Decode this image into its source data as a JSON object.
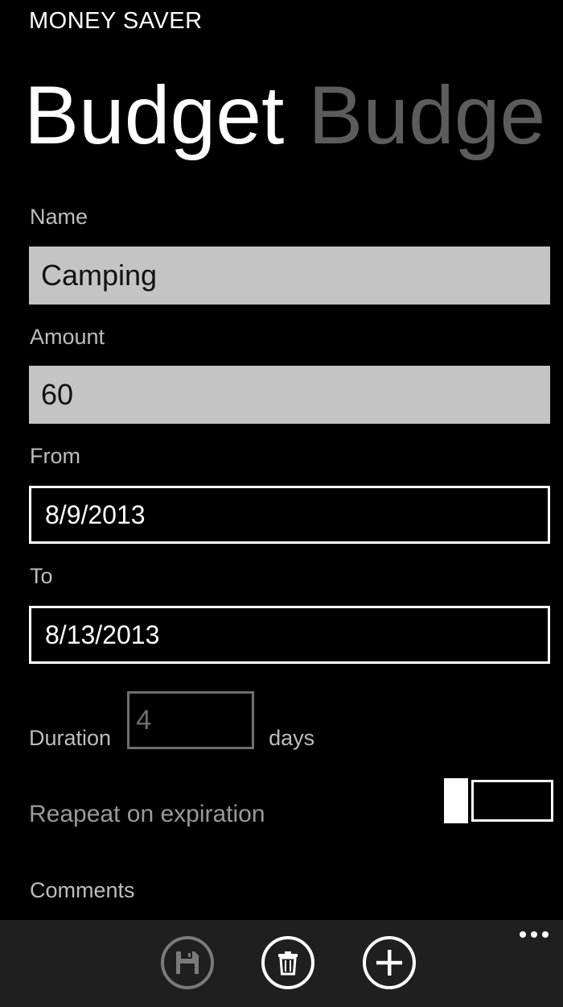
{
  "app": {
    "title": "MONEY SAVER"
  },
  "pivot": {
    "active_title": "Budget",
    "next_title": "Budge"
  },
  "form": {
    "name": {
      "label": "Name",
      "value": "Camping"
    },
    "amount": {
      "label": "Amount",
      "value": "60"
    },
    "from": {
      "label": "From",
      "value": "8/9/2013"
    },
    "to": {
      "label": "To",
      "value": "8/13/2013"
    },
    "duration": {
      "label": "Duration",
      "value": "4",
      "unit": "days"
    },
    "repeat": {
      "label": "Reapeat on expiration",
      "enabled": false
    },
    "comments": {
      "label": "Comments"
    }
  },
  "appbar": {
    "buttons": [
      {
        "icon": "save-icon",
        "enabled": false
      },
      {
        "icon": "delete-icon",
        "enabled": true
      },
      {
        "icon": "add-icon",
        "enabled": true
      }
    ],
    "more_icon": "more-dots-icon"
  },
  "colors": {
    "background": "#000000",
    "field_fill": "#c4c4c4",
    "inactive_pivot": "#5c5c5c",
    "label": "#bdbdbd",
    "appbar": "#1f1f1f"
  }
}
